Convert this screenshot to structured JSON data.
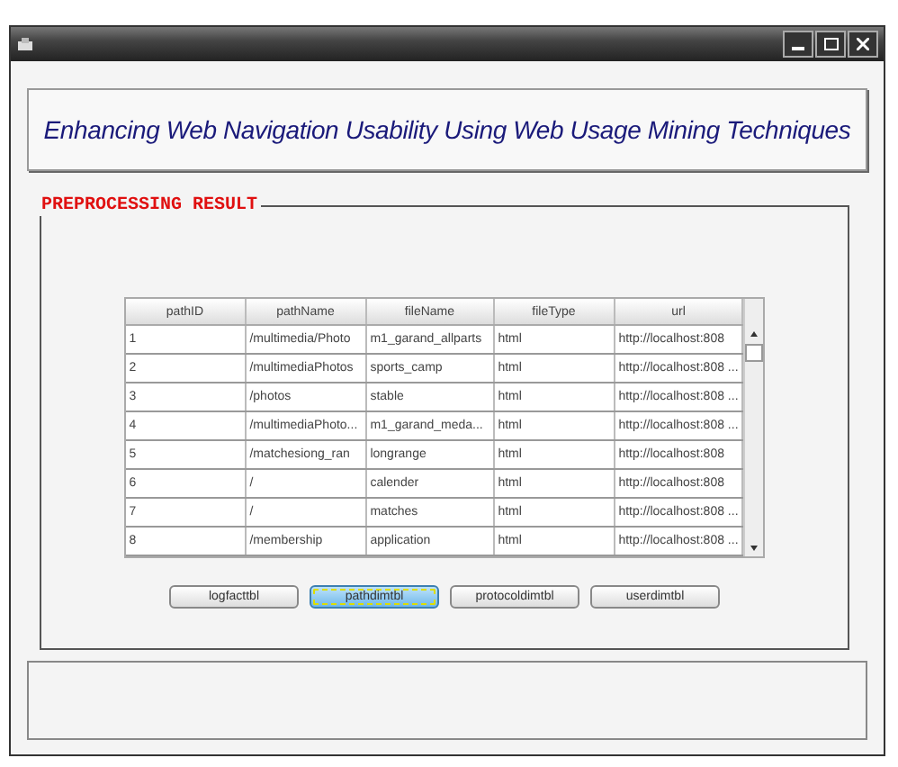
{
  "window": {
    "title": "Enhancing Web Navigation Usability Using Web Usage Mining Techniques"
  },
  "group": {
    "title": "PREPROCESSING RESULT"
  },
  "table": {
    "columns": [
      "pathID",
      "pathName",
      "fileName",
      "fileType",
      "url"
    ],
    "rows": [
      [
        "1",
        "/multimedia/Photo",
        "m1_garand_allparts",
        "html",
        "http://localhost:808"
      ],
      [
        "2",
        "/multimediaPhotos",
        "sports_camp",
        "html",
        "http://localhost:808 ..."
      ],
      [
        "3",
        "/photos",
        "stable",
        "html",
        "http://localhost:808 ..."
      ],
      [
        "4",
        "/multimediaPhoto...",
        "m1_garand_meda...",
        "html",
        "http://localhost:808 ..."
      ],
      [
        "5",
        "/matchesiong_ran",
        "longrange",
        "html",
        "http://localhost:808"
      ],
      [
        "6",
        "/",
        "calender",
        "html",
        "http://localhost:808"
      ],
      [
        "7",
        "/",
        "matches",
        "html",
        "http://localhost:808 ..."
      ],
      [
        "8",
        "/membership",
        "application",
        "html",
        "http://localhost:808 ..."
      ]
    ]
  },
  "buttons": [
    {
      "label": "logfacttbl",
      "selected": false
    },
    {
      "label": "pathdimtbl",
      "selected": true
    },
    {
      "label": "protocoldimtbl",
      "selected": false
    },
    {
      "label": "userdimtbl",
      "selected": false
    }
  ]
}
